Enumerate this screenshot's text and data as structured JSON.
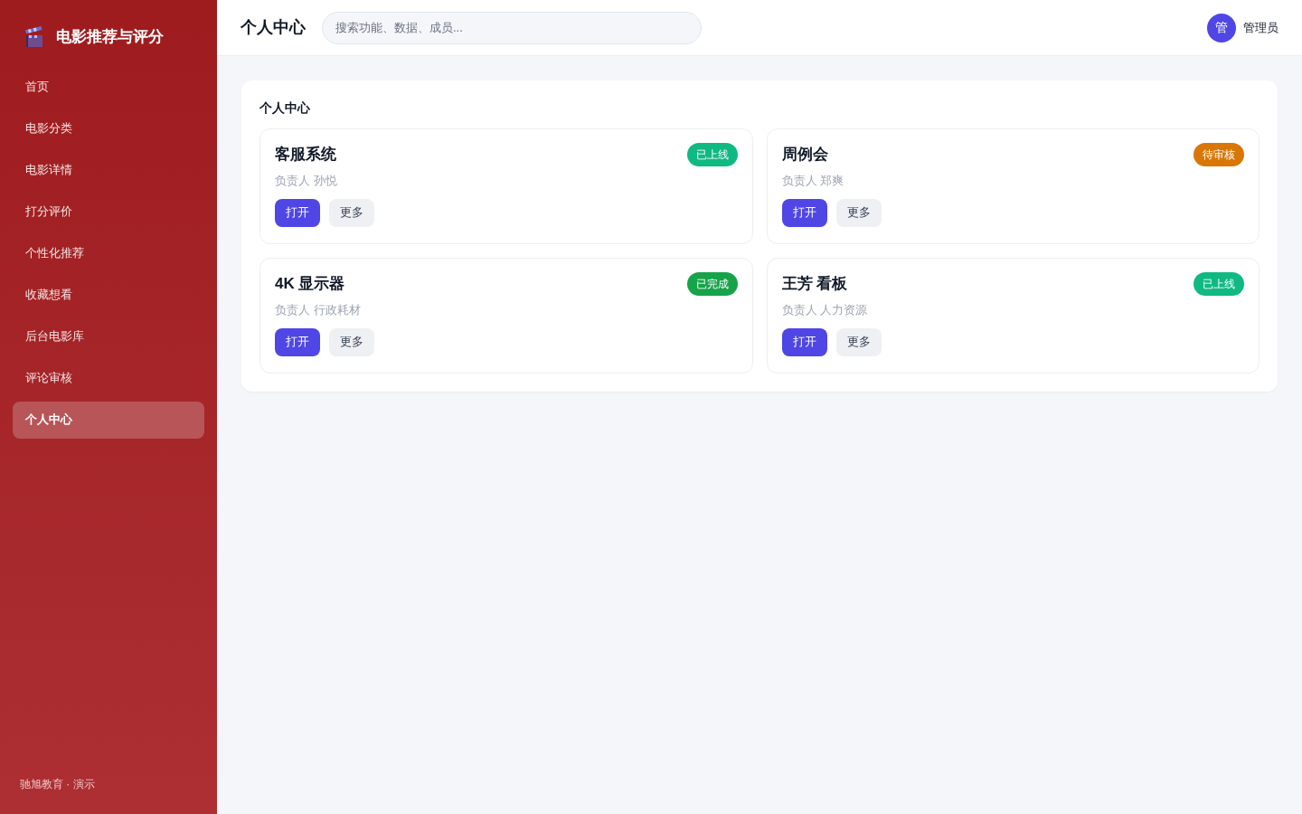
{
  "sidebar": {
    "brand": {
      "title": "电影推荐与评分"
    },
    "items": [
      {
        "label": "首页",
        "selected": false
      },
      {
        "label": "电影分类",
        "selected": false
      },
      {
        "label": "电影详情",
        "selected": false
      },
      {
        "label": "打分评价",
        "selected": false
      },
      {
        "label": "个性化推荐",
        "selected": false
      },
      {
        "label": "收藏想看",
        "selected": false
      },
      {
        "label": "后台电影库",
        "selected": false
      },
      {
        "label": "评论审核",
        "selected": false
      },
      {
        "label": "个人中心",
        "selected": true
      }
    ],
    "footer": "驰旭教育 · 演示"
  },
  "header": {
    "title": "个人中心",
    "search": {
      "placeholder": "搜索功能、数据、成员..."
    },
    "user": {
      "avatar": "管",
      "name": "管理员"
    }
  },
  "panel": {
    "title": "个人中心",
    "cards": [
      {
        "title": "客服系统",
        "status": {
          "label": "已上线",
          "color": "#10b981"
        },
        "owner": "负责人 孙悦",
        "actions": [
          {
            "label": "打开",
            "kind": "primary"
          },
          {
            "label": "更多",
            "kind": "secondary"
          }
        ]
      },
      {
        "title": "周例会",
        "status": {
          "label": "待审核",
          "color": "#d97706"
        },
        "owner": "负责人 郑爽",
        "actions": [
          {
            "label": "打开",
            "kind": "primary"
          },
          {
            "label": "更多",
            "kind": "secondary"
          }
        ]
      },
      {
        "title": "4K 显示器",
        "status": {
          "label": "已完成",
          "color": "#16a34a"
        },
        "owner": "负责人 行政耗材",
        "actions": [
          {
            "label": "打开",
            "kind": "primary"
          },
          {
            "label": "更多",
            "kind": "secondary"
          }
        ]
      },
      {
        "title": "王芳 看板",
        "status": {
          "label": "已上线",
          "color": "#10b981"
        },
        "owner": "负责人 人力资源",
        "actions": [
          {
            "label": "打开",
            "kind": "primary"
          },
          {
            "label": "更多",
            "kind": "secondary"
          }
        ]
      }
    ]
  }
}
